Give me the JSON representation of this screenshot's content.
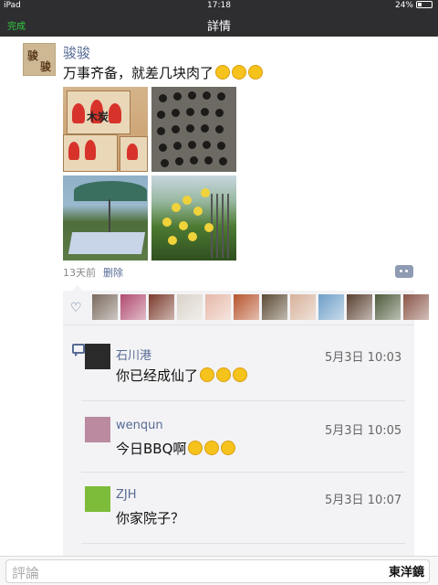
{
  "status_bar": {
    "device": "iPad",
    "time": "17:18",
    "battery": "24%"
  },
  "nav": {
    "back_label": "完成",
    "title": "詳情"
  },
  "post": {
    "author": "骏骏",
    "avatar_text": [
      "骏",
      "骏"
    ],
    "text": "万事齐备，就差几块肉了",
    "time_ago": "13天前",
    "delete_label": "删除",
    "photos": [
      "charcoal-boxes-photo",
      "grill-grate-photo",
      "garden-umbrella-photo",
      "yellow-flowers-photo"
    ],
    "photo_texts": {
      "box_label": "木炭"
    }
  },
  "likes": {
    "avatar_colors": [
      "#7a6a5e",
      "#b04a6e",
      "#7b3b2b",
      "#d9d2c8",
      "#e6b8a8",
      "#b7542c",
      "#5b4a32",
      "#d7b19a",
      "#6d9ec7",
      "#5a4030",
      "#4d5a3a",
      "#8a5548"
    ]
  },
  "comments": [
    {
      "name": "石川港",
      "time": "5月3日 10:03",
      "text": "你已经成仙了",
      "emoji_count": 3,
      "avatar_color": "#2a2a2a"
    },
    {
      "name": "wenqun",
      "time": "5月3日 10:05",
      "text": "今日BBQ啊",
      "emoji_count": 3,
      "avatar_color": "#b98aa0"
    },
    {
      "name": "ZJH",
      "time": "5月3日 10:07",
      "text": "你家院子？",
      "emoji_count": 0,
      "avatar_color": "#7dbb3a"
    }
  ],
  "input": {
    "placeholder": "評論",
    "keyboard_label": "東洋鏡"
  },
  "colors": {
    "link": "#576b95",
    "navbar": "#2e2e30",
    "done": "#2ecc40"
  }
}
